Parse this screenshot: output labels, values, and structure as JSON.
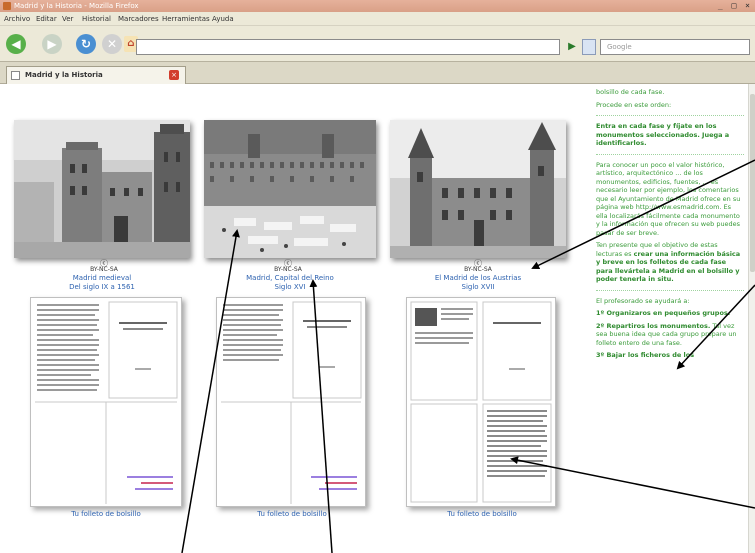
{
  "window": {
    "title": "Madrid y la Historia - Mozilla Firefox",
    "controls": "_ □ ×"
  },
  "menubar": {
    "items": [
      "Archivo",
      "Editar",
      "Ver",
      "Historial",
      "Marcadores",
      "Herramientas",
      "Ayuda"
    ]
  },
  "navbar": {
    "url_value": "",
    "search_placeholder": "Google"
  },
  "tab": {
    "label": "Madrid y la Historia"
  },
  "gallery": {
    "items": [
      {
        "license": "BY-NC-SA",
        "caption_line1": "Madrid medieval",
        "caption_line2": "Del siglo IX a 1561",
        "booklet_caption": "Tu folleto de bolsillo"
      },
      {
        "license": "BY-NC-SA",
        "caption_line1": "Madrid, Capital del Reino",
        "caption_line2": "Siglo XVI",
        "booklet_caption": "Tu folleto de bolsillo"
      },
      {
        "license": "BY-NC-SA",
        "caption_line1": "El Madrid de los Austrias",
        "caption_line2": "Siglo XVII",
        "booklet_caption": "Tu folleto de bolsillo"
      }
    ]
  },
  "sidebar": {
    "p1": "bolsillo de cada fase.",
    "p2": "Procede en este orden:",
    "p3": "Entra en cada fase y fíjate en los monumentos seleccionados. Juega a identificarlos.",
    "p4": "Para conocer un poco el valor histórico, artístico, arquitectónico ... de los monumentos, edificios, fuentes, ... es necesario leer por ejemplo, los comentarios que el Ayuntamiento de Madrid ofrece en su página web http://www.esmadrid.com. Es ella localizarás fácilmente cada monumento y la información que ofrecen su web puedes pasar de ser breve.",
    "p5a": "Ten presente que el objetivo de estas lecturas es ",
    "p5b": "crear una información básica y breve en los folletos de cada fase para llevártela a Madrid en el bolsillo y poder tenerla in situ.",
    "p6": "El profesorado se ayudará a:",
    "p7": "1º Organizaros en pequeños grupos.",
    "p8a": "2º Repartiros los monumentos.",
    "p8b": " Tal vez sea buena idea que cada grupo prepare un folleto entero de una fase.",
    "p9": "3º Bajar los ficheros de los"
  },
  "colors": {
    "link": "#2f63b0",
    "sidebar_text": "#3a9b3a",
    "title_bar": "#d9a087",
    "chrome": "#ece9d8"
  }
}
